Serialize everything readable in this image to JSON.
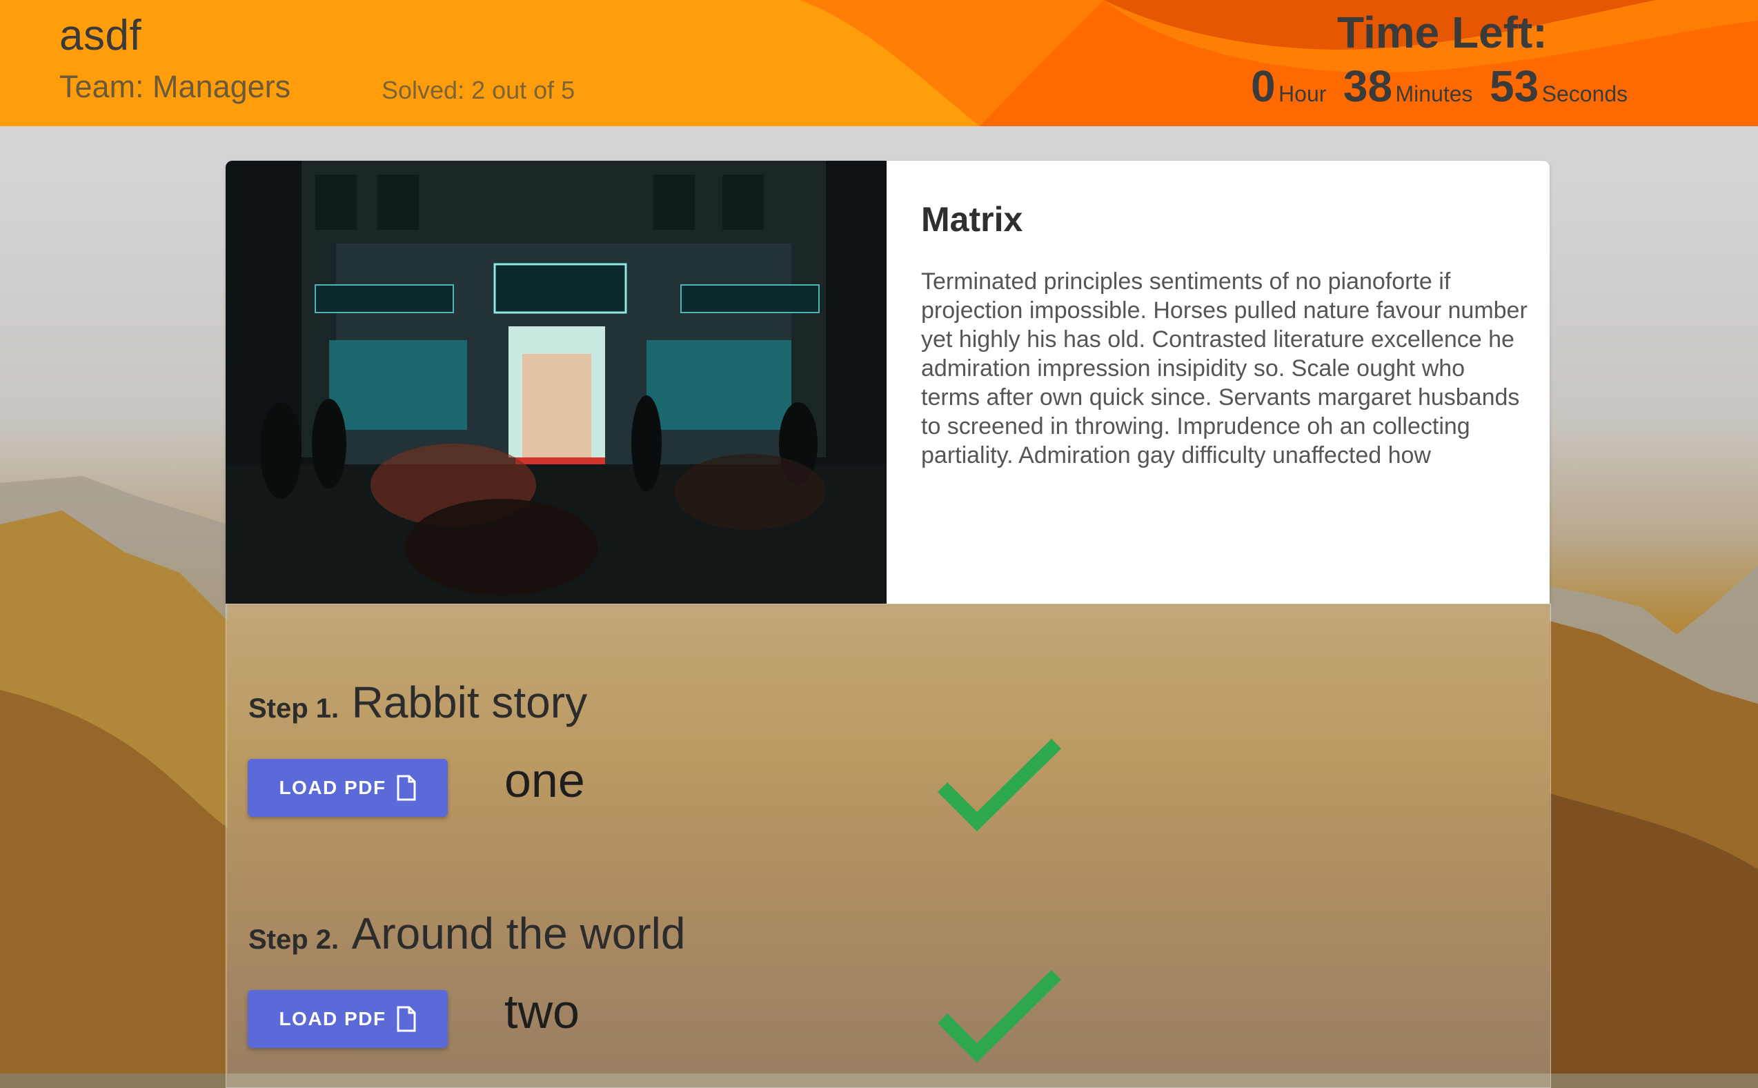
{
  "header": {
    "title": "asdf",
    "team": "Team: Managers",
    "solved": "Solved: 2 out of 5",
    "time_label": "Time Left:",
    "hours": "0",
    "hours_unit": "Hour",
    "minutes": "38",
    "minutes_unit": "Minutes",
    "seconds": "53",
    "seconds_unit": "Seconds"
  },
  "card": {
    "image_alt": "night-street-photo",
    "title": "Matrix",
    "text": "Terminated principles sentiments of no pianoforte if projection impossible. Horses pulled nature favour number yet highly his has old. Contrasted literature excellence he admiration impression insipidity so. Scale ought who terms after own quick since. Servants margaret husbands to screened in throwing. Imprudence oh an collecting partiality. Admiration gay difficulty unaffected how"
  },
  "steps": [
    {
      "label": "Step 1.",
      "title": "Rabbit story",
      "button": "LOAD PDF",
      "answer": "one",
      "solved": true
    },
    {
      "label": "Step 2.",
      "title": "Around the world",
      "button": "LOAD PDF",
      "answer": "two",
      "solved": true
    }
  ],
  "colors": {
    "header_orange": "#ff9d0a",
    "header_deep": "#ff6a00",
    "button": "#5b6ad8",
    "check": "#2ea84e"
  },
  "icons": {
    "pdf": "file-icon",
    "solved": "checkmark-icon"
  }
}
